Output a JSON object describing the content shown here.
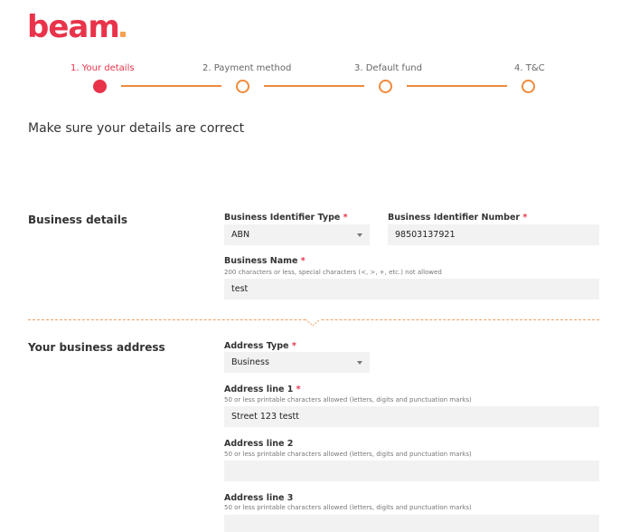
{
  "brand": {
    "logo_text": "beam",
    "colors": {
      "primary": "#e8334a",
      "accent": "#f08a3c",
      "field_bg": "#f2f2f2"
    }
  },
  "stepper": {
    "steps": [
      {
        "label": "1. Your details",
        "active": true
      },
      {
        "label": "2. Payment method",
        "active": false
      },
      {
        "label": "3. Default fund",
        "active": false
      },
      {
        "label": "4. T&C",
        "active": false
      }
    ]
  },
  "page": {
    "heading": "Make sure your details are correct"
  },
  "business_details": {
    "title": "Business details",
    "identifier_type": {
      "label": "Business Identifier Type",
      "required": "*",
      "value": "ABN"
    },
    "identifier_number": {
      "label": "Business Identifier Number",
      "required": "*",
      "value": "98503137921"
    },
    "business_name": {
      "label": "Business Name",
      "required": "*",
      "hint": "200 characters or less, special characters (<, >, +, etc.) not allowed",
      "value": "test"
    }
  },
  "business_address": {
    "title": "Your business address",
    "address_type": {
      "label": "Address Type",
      "required": "*",
      "value": "Business"
    },
    "line1": {
      "label": "Address line 1",
      "required": "*",
      "hint": "50 or less printable characters allowed (letters, digits and punctuation marks)",
      "value": "Street 123 testt"
    },
    "line2": {
      "label": "Address line 2",
      "hint": "50 or less printable characters allowed (letters, digits and punctuation marks)",
      "value": ""
    },
    "line3": {
      "label": "Address line 3",
      "hint": "50 or less printable characters allowed (letters, digits and punctuation marks)",
      "value": ""
    }
  }
}
